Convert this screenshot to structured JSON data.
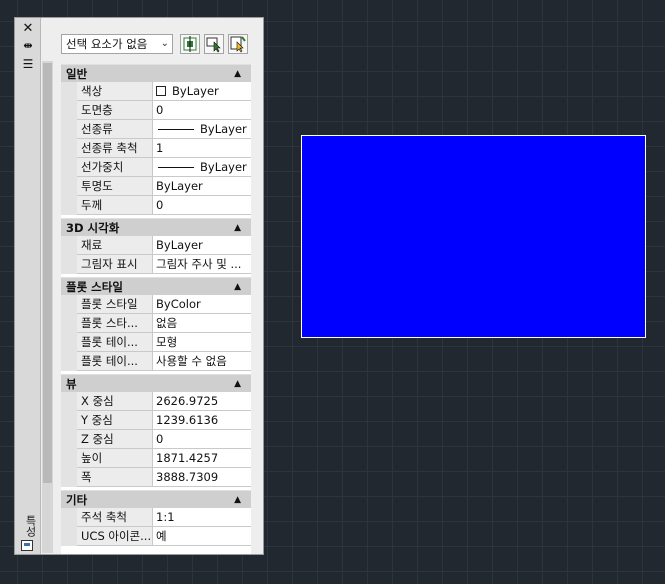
{
  "palette": {
    "titlebar": {
      "close": "✕",
      "autohide": "⇹",
      "menu": "☰",
      "title": "특성"
    },
    "selection": {
      "value": "선택 요소가 없음",
      "caret": "⌄"
    },
    "toolbar": {
      "quick_select_icon": "quick-select-icon",
      "select_objects_icon": "select-objects-icon",
      "toggle_pickadd_icon": "toggle-pickadd-icon"
    },
    "categories": [
      {
        "title": "일반",
        "rows": [
          {
            "label": "색상",
            "value": "ByLayer",
            "swatch": true
          },
          {
            "label": "도면층",
            "value": "0"
          },
          {
            "label": "선종류",
            "value": "ByLayer",
            "line": true
          },
          {
            "label": "선종류 축척",
            "value": "1"
          },
          {
            "label": "선가중치",
            "value": "ByLayer",
            "line": true
          },
          {
            "label": "투명도",
            "value": "ByLayer"
          },
          {
            "label": "두께",
            "value": "0"
          }
        ]
      },
      {
        "title": "3D 시각화",
        "rows": [
          {
            "label": "재료",
            "value": "ByLayer"
          },
          {
            "label": "그림자 표시",
            "value": "그림자 주사 및 ..."
          }
        ]
      },
      {
        "title": "플롯 스타일",
        "rows": [
          {
            "label": "플롯 스타일",
            "value": "ByColor"
          },
          {
            "label": "플롯 스타...",
            "value": "없음"
          },
          {
            "label": "플롯 테이...",
            "value": "모형"
          },
          {
            "label": "플롯 테이...",
            "value": "사용할 수 없음"
          }
        ]
      },
      {
        "title": "뷰",
        "rows": [
          {
            "label": "X 중심",
            "value": "2626.9725"
          },
          {
            "label": "Y 중심",
            "value": "1239.6136"
          },
          {
            "label": "Z 중심",
            "value": "0"
          },
          {
            "label": "높이",
            "value": "1871.4257"
          },
          {
            "label": "폭",
            "value": "3888.7309"
          }
        ]
      },
      {
        "title": "기타",
        "rows": [
          {
            "label": "주석 축척",
            "value": "1:1"
          },
          {
            "label": "UCS 아이콘...",
            "value": "예"
          }
        ]
      }
    ]
  },
  "canvas": {
    "rectangle_color": "#0000ff"
  }
}
